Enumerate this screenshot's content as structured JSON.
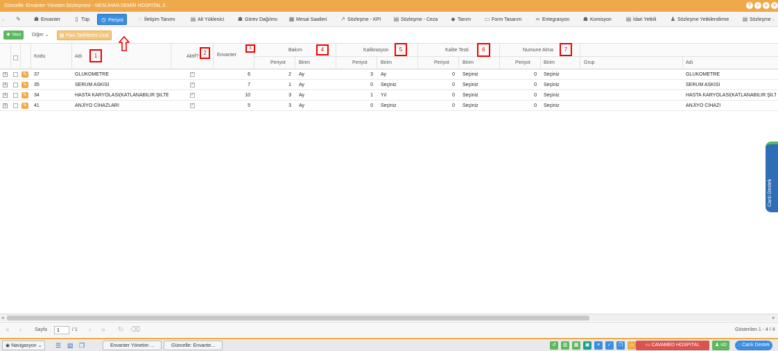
{
  "window": {
    "title": "Güncelle: Envanter Yönetim Sözleşmesi - NESLİHAN DEMİR HOSPITAL 3",
    "controls": [
      "?",
      "−",
      "+",
      "×"
    ]
  },
  "tabs": [
    {
      "label": "Envanter",
      "icon": "people-icon"
    },
    {
      "label": "Tüp",
      "icon": "tube-icon"
    },
    {
      "label": "Periyot",
      "icon": "clock-icon",
      "active": true
    },
    {
      "label": "İletişim Tanımı",
      "icon": "chat-icon"
    },
    {
      "label": "Alt Yüklenici",
      "icon": "document-icon"
    },
    {
      "label": "Görev Dağılımı",
      "icon": "people-icon"
    },
    {
      "label": "Mesai Saatleri",
      "icon": "calendar-icon"
    },
    {
      "label": "Sözleşme - KPI",
      "icon": "chart-icon"
    },
    {
      "label": "Sözleşme - Ceza",
      "icon": "document-icon"
    },
    {
      "label": "Tanım",
      "icon": "tag-icon"
    },
    {
      "label": "Form Tasarım",
      "icon": "form-icon"
    },
    {
      "label": "Entegrasyon",
      "icon": "link-icon"
    },
    {
      "label": "Komisyon",
      "icon": "people-icon"
    },
    {
      "label": "İdari Yetkili",
      "icon": "document-icon"
    },
    {
      "label": "Sözleşme Yetkilendirme",
      "icon": "person-icon"
    },
    {
      "label": "Sözleşme",
      "icon": "document-icon"
    }
  ],
  "toolbar": {
    "new_label": "Yeni",
    "other_label": "Diğer",
    "plan_label": "Plan Tarihlerini Uzat"
  },
  "grid": {
    "headers": {
      "kodu": "Kodu",
      "adi": "Adı",
      "aktif": "Aktif?",
      "envanter": "Envanter",
      "bakim": "Bakım",
      "kalibrasyon": "Kalibrasyon",
      "kalite": "Kalite Testi",
      "numune": "Numune Alma",
      "periyot": "Periyot",
      "birim": "Birim",
      "grup": "Grup",
      "adi2": "Adı"
    },
    "rows": [
      {
        "kodu": "37",
        "adi": "GLUKOMETRE",
        "aktif": true,
        "envanter": "6",
        "bakim_p": "2",
        "bakim_b": "Ay",
        "kal_p": "3",
        "kal_b": "Ay",
        "kt_p": "0",
        "kt_b": "Seçiniz",
        "na_p": "0",
        "na_b": "Seçiniz",
        "grup": "",
        "adi2": "GLUKOMETRE"
      },
      {
        "kodu": "35",
        "adi": "SERUM ASKISI",
        "aktif": true,
        "envanter": "7",
        "bakim_p": "1",
        "bakim_b": "Ay",
        "kal_p": "0",
        "kal_b": "Seçiniz",
        "kt_p": "0",
        "kt_b": "Seçiniz",
        "na_p": "0",
        "na_b": "Seçiniz",
        "grup": "",
        "adi2": "SERUM ASKISI"
      },
      {
        "kodu": "34",
        "adi": "HASTA KARYOLASI(KATLANABILIR ŞILTE...",
        "aktif": true,
        "envanter": "10",
        "bakim_p": "3",
        "bakim_b": "Ay",
        "kal_p": "1",
        "kal_b": "Yıl",
        "kt_p": "0",
        "kt_b": "Seçiniz",
        "na_p": "0",
        "na_b": "Seçiniz",
        "grup": "",
        "adi2": "HASTA KARYOLASI(KATLANABILIR ŞILTE..."
      },
      {
        "kodu": "41",
        "adi": "ANJİYO CİHAZLARI",
        "aktif": true,
        "envanter": "5",
        "bakim_p": "3",
        "bakim_b": "Ay",
        "kal_p": "0",
        "kal_b": "Seçiniz",
        "kt_p": "0",
        "kt_b": "Seçiniz",
        "na_p": "0",
        "na_b": "Seçiniz",
        "grup": "",
        "adi2": "ANJİYO CİHAZI"
      }
    ]
  },
  "annotations": [
    "1",
    "2",
    "3",
    "4",
    "5",
    "6",
    "7"
  ],
  "pager": {
    "page_label": "Sayfa",
    "page_value": "1",
    "page_total": "/ 1",
    "summary": "Gösterilen 1 - 4 / 4"
  },
  "taskbar": {
    "nav_label": "Navigasyon",
    "window1": "Envanter Yönetim ...",
    "window2": "Güncelle: Envante...",
    "hospital": "CAVAMED HOSPITAL",
    "user": "nD",
    "support": "Canlı Destek"
  },
  "side_tab": {
    "label": "Canlı Destek"
  },
  "colors": {
    "accent": "#f0a94a",
    "active_tab": "#3b8de0",
    "annotation": "#ee0000",
    "new_button": "#5cb85c"
  }
}
